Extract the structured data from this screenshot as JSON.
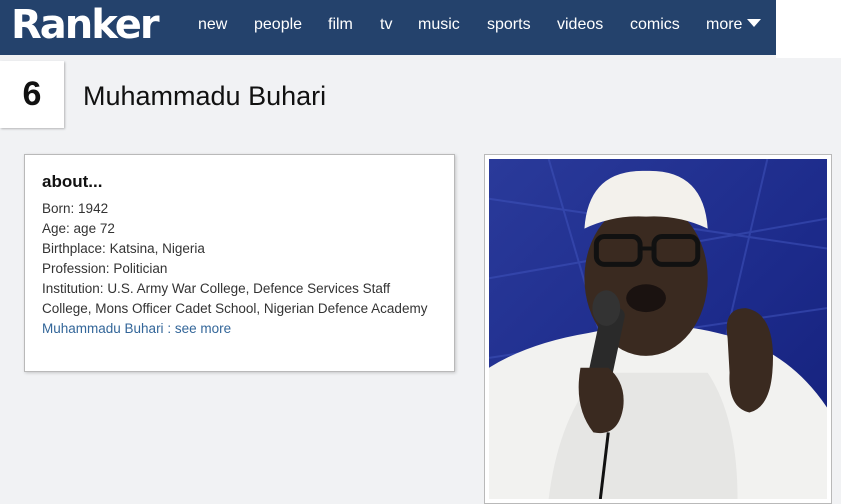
{
  "header": {
    "logo_text": "Ranker",
    "nav": [
      "new",
      "people",
      "film",
      "tv",
      "music",
      "sports",
      "videos",
      "comics",
      "more"
    ],
    "bar_color": "#24426c"
  },
  "item": {
    "rank": "6",
    "name": "Muhammadu Buhari"
  },
  "about": {
    "heading": "about...",
    "facts": [
      {
        "label": "Born:",
        "value": "1942"
      },
      {
        "label": "Age:",
        "value": "age 72"
      },
      {
        "label": "Birthplace:",
        "value": "Katsina, Nigeria"
      },
      {
        "label": "Profession:",
        "value": "Politician"
      },
      {
        "label": "Institution:",
        "value": "U.S. Army War College, Defence Services Staff College, Mons Officer Cadet School, Nigerian Defence Academy"
      }
    ],
    "link_name": "Muhammadu Buhari",
    "separator": ":",
    "see_more": "see more",
    "link_color": "#336699"
  },
  "photo": {
    "icon": "portrait-photo"
  }
}
